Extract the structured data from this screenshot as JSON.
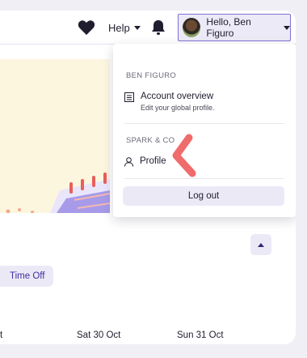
{
  "header": {
    "help_label": "Help",
    "user_greeting": "Hello, Ben Figuro"
  },
  "dropdown": {
    "user_section_label": "BEN FIGURO",
    "account_overview": {
      "title": "Account overview",
      "subtitle": "Edit your global profile."
    },
    "company_section_label": "SPARK & CO",
    "profile_label": "Profile",
    "logout_label": "Log out"
  },
  "content": {
    "time_off_label": "Time Off",
    "days": [
      {
        "label": "t"
      },
      {
        "label": "Sat 30 Oct"
      },
      {
        "label": "Sun 31 Oct"
      }
    ]
  },
  "colors": {
    "accent": "#7d72d6",
    "annotation": "#f06b6b",
    "banner": "#fdf6df"
  },
  "icons": [
    "heart-icon",
    "chevron-down-icon",
    "bell-icon",
    "list-icon",
    "person-icon",
    "chevron-up-icon"
  ]
}
